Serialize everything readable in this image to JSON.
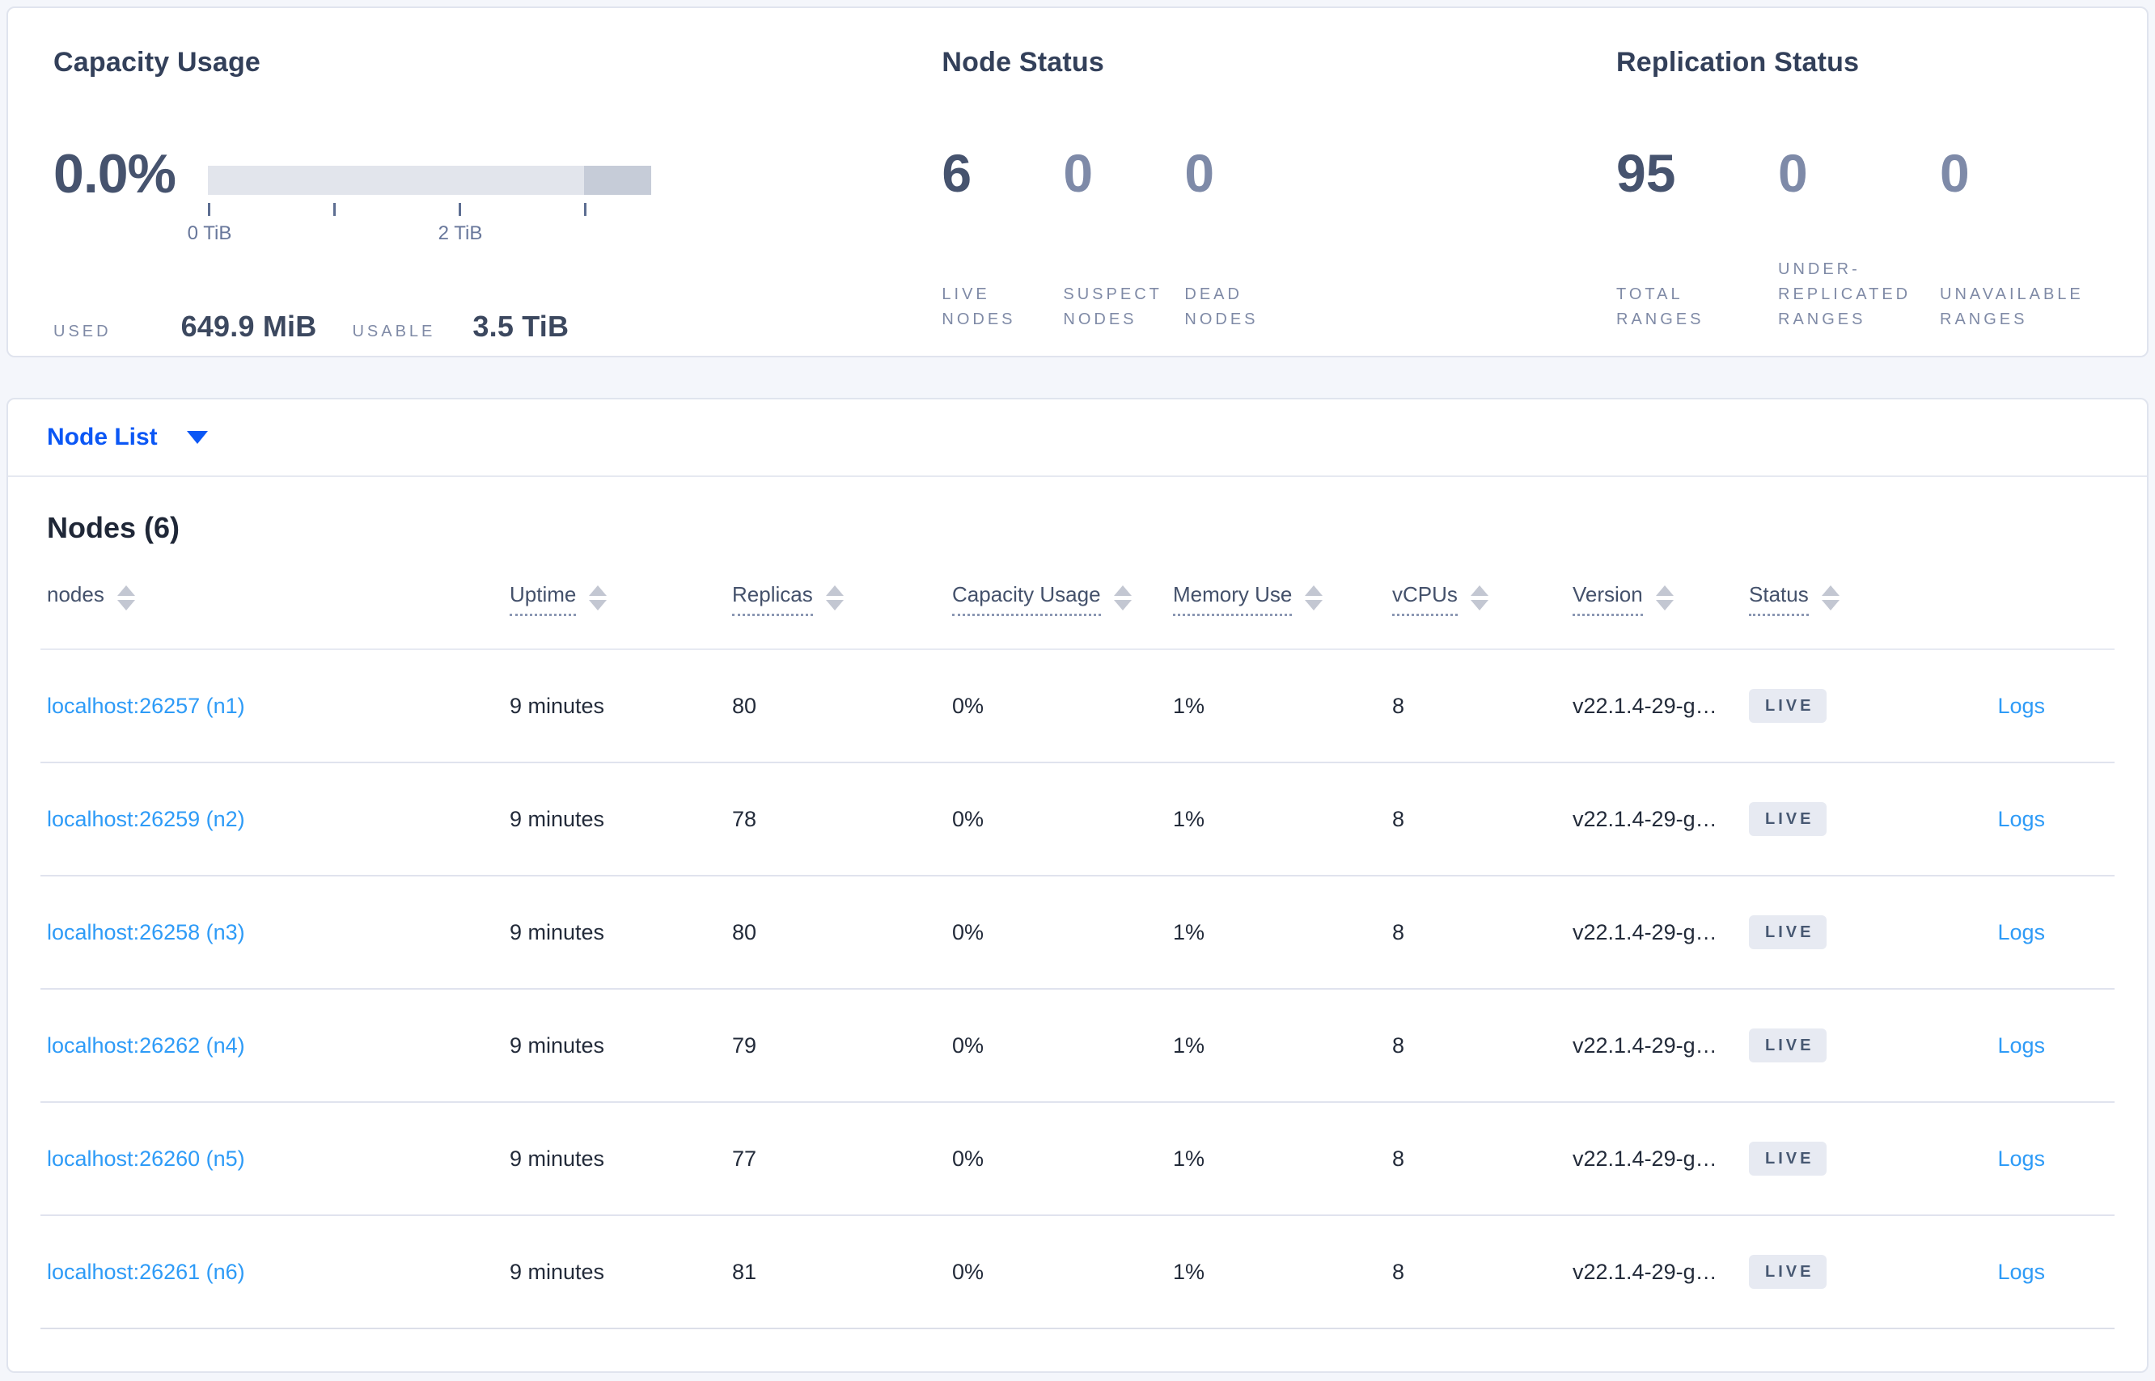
{
  "capacity_usage": {
    "title": "Capacity Usage",
    "percent": "0.0%",
    "axis_tick_0": "0 TiB",
    "axis_tick_2": "2 TiB",
    "used_label": "USED",
    "used_value": "649.9 MiB",
    "usable_label": "USABLE",
    "usable_value": "3.5 TiB",
    "bar": {
      "usable_total": "3.5 TiB",
      "used_fraction_percent": 0.0
    }
  },
  "node_status": {
    "title": "Node Status",
    "stats": [
      {
        "value": "6",
        "label": "LIVE NODES"
      },
      {
        "value": "0",
        "label": "SUSPECT NODES"
      },
      {
        "value": "0",
        "label": "DEAD NODES"
      }
    ]
  },
  "replication_status": {
    "title": "Replication Status",
    "stats": [
      {
        "value": "95",
        "label": "TOTAL RANGES"
      },
      {
        "value": "0",
        "label": "UNDER-REPLICATED RANGES"
      },
      {
        "value": "0",
        "label": "UNAVAILABLE RANGES"
      }
    ]
  },
  "node_list": {
    "selector_label": "Node List",
    "heading": "Nodes (6)"
  },
  "table": {
    "columns": [
      "nodes",
      "Uptime",
      "Replicas",
      "Capacity Usage",
      "Memory Use",
      "vCPUs",
      "Version",
      "Status"
    ],
    "rows": [
      {
        "node": "localhost:26257 (n1)",
        "uptime": "9 minutes",
        "replicas": "80",
        "capacity": "0%",
        "memory": "1%",
        "vcpus": "8",
        "version": "v22.1.4-29-g…",
        "status": "LIVE",
        "logs": "Logs"
      },
      {
        "node": "localhost:26259 (n2)",
        "uptime": "9 minutes",
        "replicas": "78",
        "capacity": "0%",
        "memory": "1%",
        "vcpus": "8",
        "version": "v22.1.4-29-g…",
        "status": "LIVE",
        "logs": "Logs"
      },
      {
        "node": "localhost:26258 (n3)",
        "uptime": "9 minutes",
        "replicas": "80",
        "capacity": "0%",
        "memory": "1%",
        "vcpus": "8",
        "version": "v22.1.4-29-g…",
        "status": "LIVE",
        "logs": "Logs"
      },
      {
        "node": "localhost:26262 (n4)",
        "uptime": "9 minutes",
        "replicas": "79",
        "capacity": "0%",
        "memory": "1%",
        "vcpus": "8",
        "version": "v22.1.4-29-g…",
        "status": "LIVE",
        "logs": "Logs"
      },
      {
        "node": "localhost:26260 (n5)",
        "uptime": "9 minutes",
        "replicas": "77",
        "capacity": "0%",
        "memory": "1%",
        "vcpus": "8",
        "version": "v22.1.4-29-g…",
        "status": "LIVE",
        "logs": "Logs"
      },
      {
        "node": "localhost:26261 (n6)",
        "uptime": "9 minutes",
        "replicas": "81",
        "capacity": "0%",
        "memory": "1%",
        "vcpus": "8",
        "version": "v22.1.4-29-g…",
        "status": "LIVE",
        "logs": "Logs"
      }
    ]
  },
  "colors": {
    "accent_blue": "#0b57f5",
    "link_blue": "#2e9bf7",
    "stat_primary": "#46536e",
    "stat_dim": "#7e8aa8",
    "badge_bg": "#e7eaf2"
  }
}
